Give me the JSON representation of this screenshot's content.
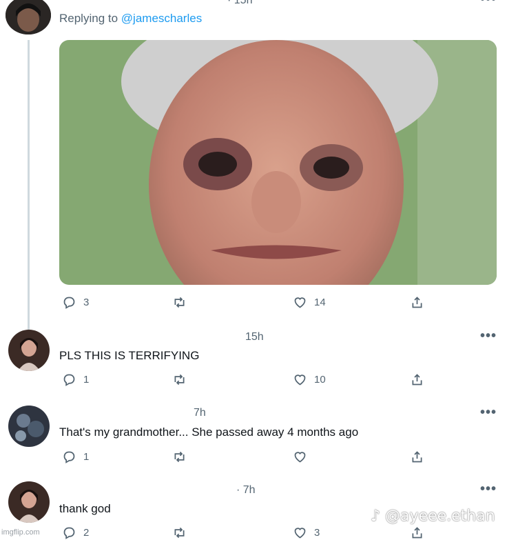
{
  "post": {
    "time": "· 15h",
    "replying_prefix": "Replying to",
    "replying_handle": "@jamescharles",
    "stats": {
      "replies": "3",
      "likes": "14"
    }
  },
  "replies": [
    {
      "time": "15h",
      "text": "PLS THIS IS TERRIFYING",
      "replies": "1",
      "likes": "10"
    },
    {
      "time": "7h",
      "text": "That's my grandmother... She passed away 4 months ago",
      "replies": "1",
      "likes": ""
    },
    {
      "time": "· 7h",
      "text": "thank god",
      "replies": "2",
      "likes": "3"
    }
  ],
  "more_label": "•••",
  "watermark": {
    "tiktok": "♪ @ayeee.ethan",
    "imgflip": "imgflip.com"
  },
  "colors": {
    "muted": "#536471",
    "thread_line": "#cfd9de",
    "photo_bg": "#7fa06e"
  },
  "icons": [
    "reply-icon",
    "retweet-icon",
    "like-icon",
    "share-icon",
    "more-icon"
  ]
}
